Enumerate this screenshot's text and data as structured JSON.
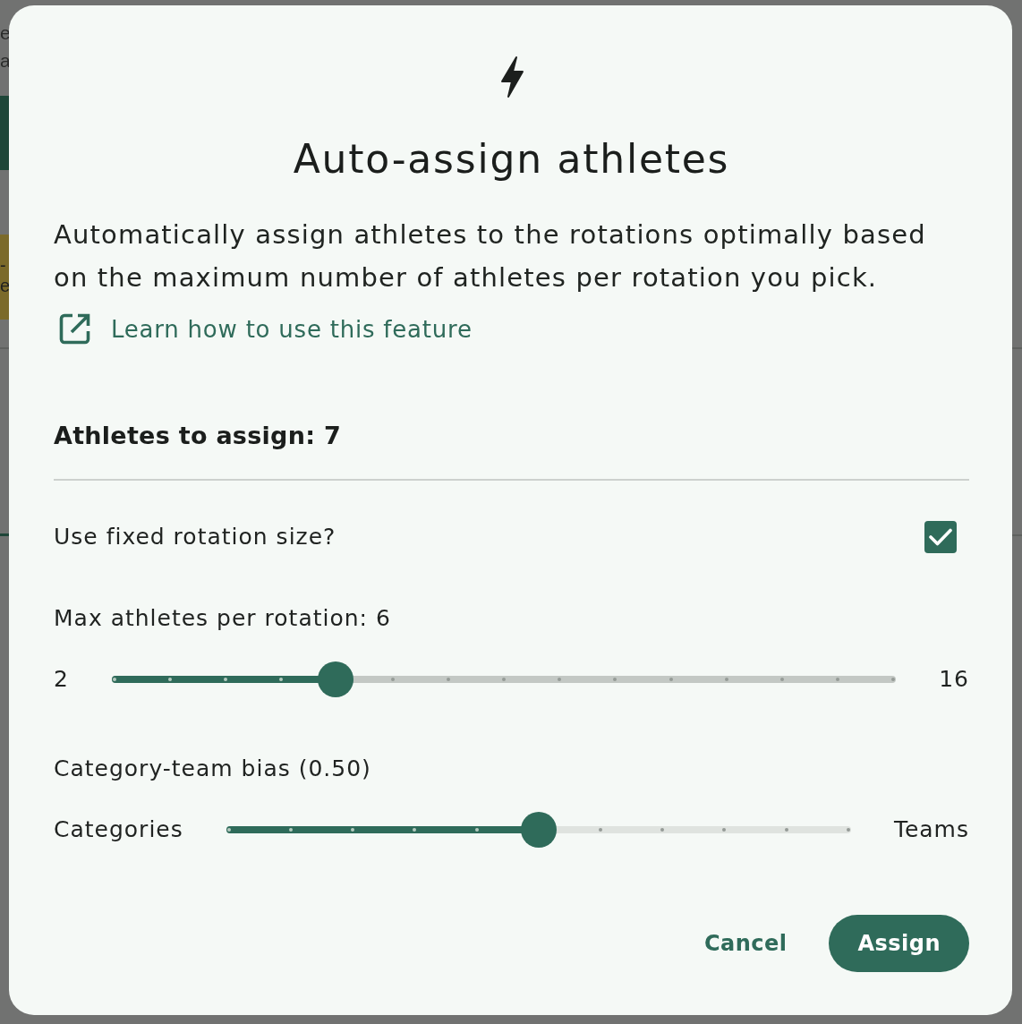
{
  "background_page": {
    "side_text": [
      "e",
      "a"
    ],
    "banner_text": [
      "-",
      "e"
    ]
  },
  "dialog": {
    "title": "Auto-assign athletes",
    "description": "Automatically assign athletes to the rotations optimally based on the maximum number of athletes per rotation you pick.",
    "link": "Learn how to use this feature",
    "summary": "Athletes to assign: 7",
    "settings": [
      {
        "kind": "checkbox",
        "label": "Use fixed rotation size?",
        "checked": true
      },
      {
        "kind": "slider",
        "label": "Max athletes per rotation: 6",
        "min_label": "2",
        "max_label": "16",
        "level": 0.2857
      },
      {
        "kind": "slider",
        "label": "Category-team bias (0.50)",
        "min_label": "Categories",
        "max_label": "Teams",
        "level": 0.5
      }
    ],
    "buttons": [
      {
        "kind": "text",
        "label": "Cancel"
      },
      {
        "kind": "filled",
        "label": "Assign"
      }
    ]
  }
}
